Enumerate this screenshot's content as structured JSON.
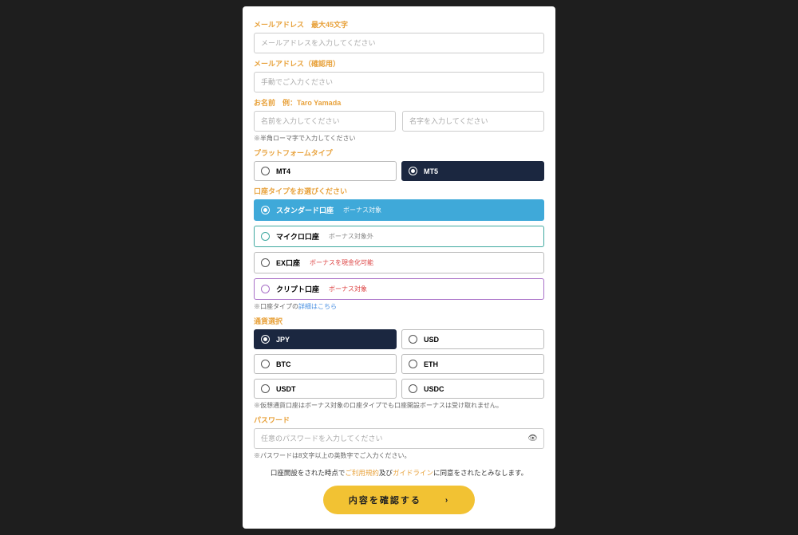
{
  "email": {
    "label": "メールアドレス　最大45文字",
    "placeholder": "メールアドレスを入力してください"
  },
  "email_confirm": {
    "label": "メールアドレス（確認用）",
    "placeholder": "手動でご入力ください"
  },
  "name": {
    "label": "お名前　例：Taro Yamada",
    "first_placeholder": "名前を入力してください",
    "last_placeholder": "名字を入力してください",
    "hint": "※半角ローマ字で入力してください"
  },
  "platform": {
    "label": "プラットフォームタイプ",
    "options": [
      "MT4",
      "MT5"
    ],
    "selected": "MT5"
  },
  "account_type": {
    "label": "口座タイプをお選びください",
    "options": [
      {
        "name": "スタンダード口座",
        "tag": "ボーナス対象",
        "style": "blue",
        "tag_style": "white",
        "selected": true
      },
      {
        "name": "マイクロ口座",
        "tag": "ボーナス対象外",
        "style": "teal-b",
        "tag_style": "gray",
        "selected": false
      },
      {
        "name": "EX口座",
        "tag": "ボーナスを現金化可能",
        "style": "",
        "tag_style": "red",
        "selected": false
      },
      {
        "name": "クリプト口座",
        "tag": "ボーナス対象",
        "style": "purple-b",
        "tag_style": "red",
        "selected": false
      }
    ],
    "hint_prefix": "※口座タイプの",
    "hint_link": "詳細はこちら"
  },
  "currency": {
    "label": "通貨選択",
    "options": [
      "JPY",
      "USD",
      "BTC",
      "ETH",
      "USDT",
      "USDC"
    ],
    "selected": "JPY",
    "hint": "※仮想通貨口座はボーナス対象の口座タイプでも口座開設ボーナスは受け取れません。"
  },
  "password": {
    "label": "パスワード",
    "placeholder": "任意のパスワードを入力してください",
    "hint": "※パスワードは8文字以上の英数字でご入力ください。"
  },
  "consent": {
    "prefix": "口座開設をされた時点で",
    "link1": "ご利用規約",
    "mid": "及び",
    "link2": "ガイドライン",
    "suffix": "に同意をされたとみなします。"
  },
  "submit_label": "内容を確認する"
}
